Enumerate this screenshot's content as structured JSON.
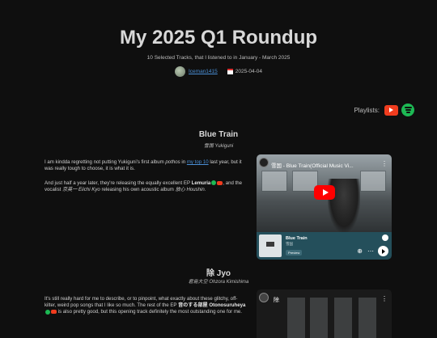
{
  "header": {
    "title": "My 2025 Q1 Roundup",
    "subtitle": "10 Selected Tracks, that I listened to in January - March 2025",
    "author": "Iceman1415",
    "date": "2025-04-04"
  },
  "playlists": {
    "label": "Playlists:",
    "icons": [
      "youtube-icon",
      "spotify-icon"
    ]
  },
  "tracks": [
    {
      "title": "Blue Train",
      "artist": "雪国 Yukiguni",
      "p1": {
        "a": "I am kindda regretting not putting Yukiguni's first album ",
        "b": "pothos",
        "c": " in ",
        "link": "my top 10",
        "d": " last year, but it was really tough to choose, it is what it is."
      },
      "p2": {
        "a": "And just half a year later, they're releasing the equally excellent EP ",
        "b": "Lemuria",
        "c": ", and the vocalist ",
        "d": "京英一 Eiichi Kyo",
        "e": " releasing his own acoustic album ",
        "f": "放心 Houshin",
        "g": "."
      },
      "video": {
        "title": "雪国 - Blue Train(Official Music Vi..."
      },
      "spotify": {
        "track": "Blue Train",
        "artist": "雪国",
        "preview": "Preview"
      }
    },
    {
      "title": "除 Jyo",
      "artist": "君島大空 Ohzora Kimishima",
      "p1": {
        "a": "It's still really hard for me to describe, or to pinpoint, what exactly about these glitchy, off-kilter, weird pop songs that I like so much. The rest of the EP ",
        "b": "音のする部屋 Otonosuruheya",
        "c": " is also pretty good, but this opening track definitely the most outstanding one for me."
      },
      "video": {
        "title": "除"
      }
    }
  ],
  "colors": {
    "background": "#0f0f0f",
    "link": "#4a8fd6",
    "youtube": "#f03c1e",
    "spotify": "#1db954"
  }
}
